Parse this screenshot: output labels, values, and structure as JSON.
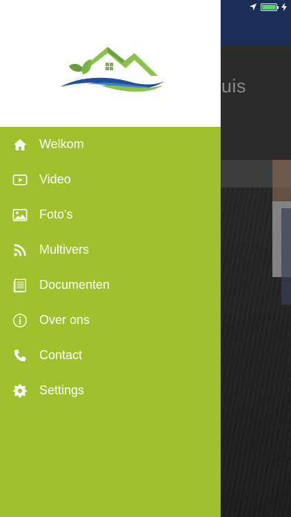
{
  "background": {
    "title": "uis"
  },
  "drawer": {
    "items": [
      {
        "label": "Welkom",
        "icon": "home-icon"
      },
      {
        "label": "Video",
        "icon": "video-play-icon"
      },
      {
        "label": "Foto's",
        "icon": "image-icon"
      },
      {
        "label": "Multivers",
        "icon": "rss-icon"
      },
      {
        "label": "Documenten",
        "icon": "document-icon"
      },
      {
        "label": "Over ons",
        "icon": "info-icon"
      },
      {
        "label": "Contact",
        "icon": "phone-icon"
      },
      {
        "label": "Settings",
        "icon": "gear-icon"
      }
    ]
  },
  "colors": {
    "drawer_background": "#a0c12e",
    "header_background": "#ffffff",
    "statusbar_background": "#1a2f58",
    "menu_text": "#ffffff"
  }
}
